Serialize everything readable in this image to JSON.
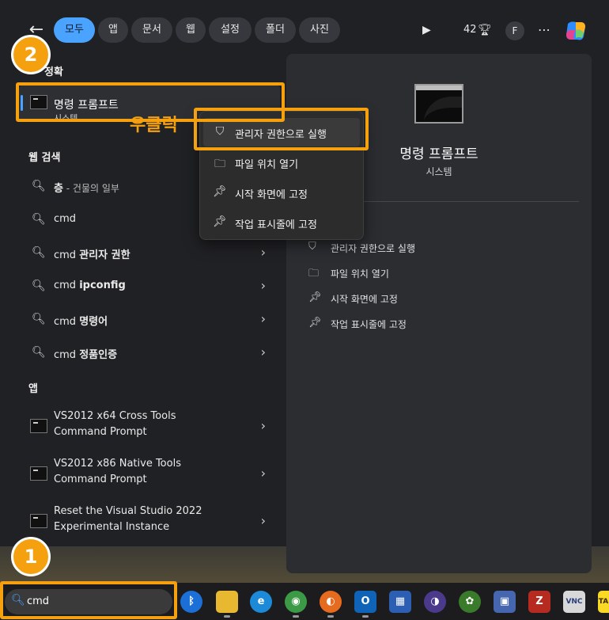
{
  "filters": {
    "back_icon": "back-arrow-icon",
    "chips": [
      "모두",
      "앱",
      "문서",
      "웹",
      "설정",
      "폴더",
      "사진"
    ],
    "active_index": 0
  },
  "header_right": {
    "play_icon": "play-icon",
    "points": "42",
    "trophy_icon": "trophy-icon",
    "profile_initial": "F",
    "more_icon": "more-icon",
    "copilot_icon": "copilot-icon"
  },
  "best_match": {
    "section": "정확",
    "title": "명령 프롬프트",
    "subtitle": "시스템"
  },
  "web_search": {
    "section": "웹 검색",
    "items": [
      {
        "bold": "층",
        "rest": " - 건물의 일부",
        "chevron": false
      },
      {
        "plain": "cmd",
        "bold": "",
        "chevron": false
      },
      {
        "plain": "cmd ",
        "bold": "관리자 권한",
        "chevron": true
      },
      {
        "plain": "cmd ",
        "bold": "ipconfig",
        "chevron": true
      },
      {
        "plain": "cmd ",
        "bold": "명령어",
        "chevron": true
      },
      {
        "plain": "cmd ",
        "bold": "정품인증",
        "chevron": true
      }
    ]
  },
  "apps": {
    "section": "앱",
    "items": [
      {
        "line1": "VS2012 x64 Cross Tools",
        "line2": "Command Prompt"
      },
      {
        "line1": "VS2012 x86 Native Tools",
        "line2": "Command Prompt"
      },
      {
        "line1": "Reset the Visual Studio 2022",
        "line2": "Experimental Instance"
      }
    ]
  },
  "context_menu": {
    "items": [
      {
        "icon": "shield-icon",
        "label": "관리자 권한으로 실행"
      },
      {
        "icon": "folder-icon",
        "label": "파일 위치 열기"
      },
      {
        "icon": "pin-icon",
        "label": "시작 화면에 고정"
      },
      {
        "icon": "pin-icon",
        "label": "작업 표시줄에 고정"
      }
    ]
  },
  "preview": {
    "title": "명령 프롬프트",
    "subtitle": "시스템",
    "actions": [
      {
        "icon": "shield-icon",
        "label": "관리자 권한으로 실행"
      },
      {
        "icon": "folder-icon",
        "label": "파일 위치 열기"
      },
      {
        "icon": "pin-icon",
        "label": "시작 화면에 고정"
      },
      {
        "icon": "pin-icon",
        "label": "작업 표시줄에 고정"
      }
    ]
  },
  "annotations": {
    "step1": "1",
    "step2": "2",
    "right_click_label": "우클릭",
    "color": "#f5a00f"
  },
  "taskbar": {
    "search_value": "cmd",
    "apps": [
      {
        "name": "bluetooth-app",
        "glyph": "ᛒ",
        "color": "#1b6fd6"
      },
      {
        "name": "file-explorer",
        "glyph": "",
        "color": "#e8b830"
      },
      {
        "name": "edge",
        "glyph": "e",
        "color": "#1c8ad9"
      },
      {
        "name": "chrome",
        "glyph": "◉",
        "color": "#3c9a47"
      },
      {
        "name": "firefox",
        "glyph": "◐",
        "color": "#e66b1f"
      },
      {
        "name": "outlook",
        "glyph": "O",
        "color": "#0f64b8"
      },
      {
        "name": "network-app",
        "glyph": "▦",
        "color": "#2c5fb3"
      },
      {
        "name": "eclipse",
        "glyph": "◑",
        "color": "#4b3a8c"
      },
      {
        "name": "frog-app",
        "glyph": "✿",
        "color": "#3a7b2b"
      },
      {
        "name": "remote-desktop",
        "glyph": "▣",
        "color": "#4766b0"
      },
      {
        "name": "filezilla",
        "glyph": "Z",
        "color": "#b62a1f"
      },
      {
        "name": "vnc-viewer",
        "glyph": "VNC",
        "color": "#d8d8d8"
      },
      {
        "name": "kakaotalk",
        "glyph": "TA",
        "color": "#f9d923"
      }
    ]
  }
}
